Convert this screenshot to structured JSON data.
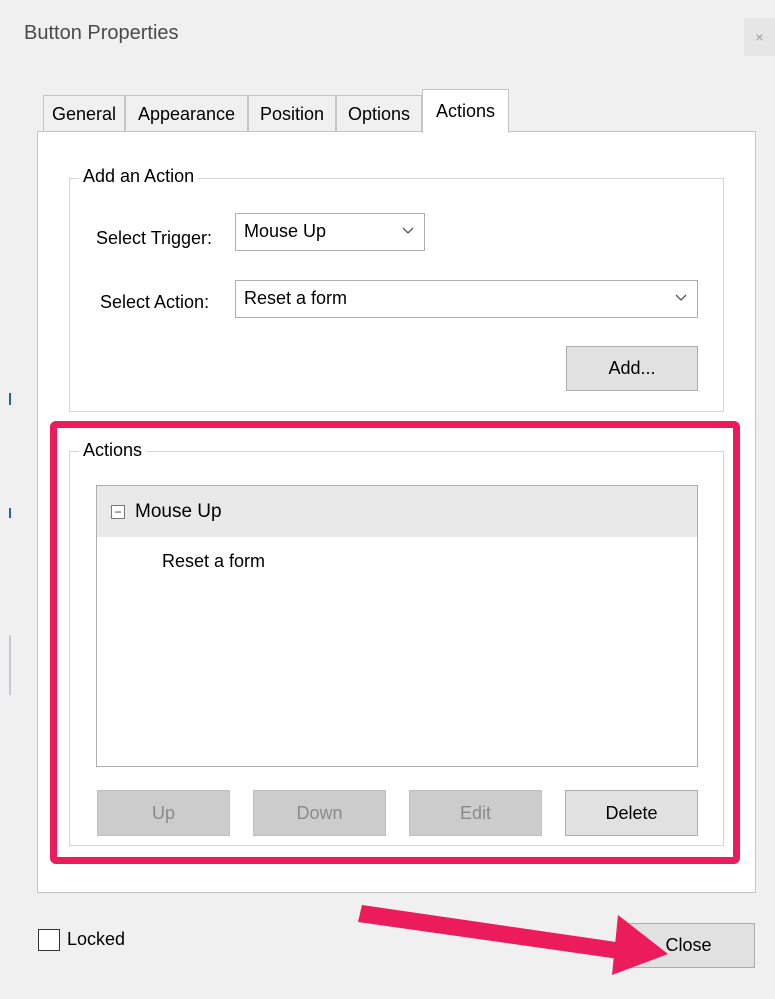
{
  "window": {
    "title": "Button Properties",
    "close_glyph": "×"
  },
  "tabs": [
    {
      "label": "General",
      "active": false
    },
    {
      "label": "Appearance",
      "active": false
    },
    {
      "label": "Position",
      "active": false
    },
    {
      "label": "Options",
      "active": false
    },
    {
      "label": "Actions",
      "active": true
    }
  ],
  "add_action": {
    "group_label": "Add an Action",
    "trigger_label": "Select Trigger:",
    "trigger_value": "Mouse Up",
    "action_label": "Select Action:",
    "action_value": "Reset a form",
    "add_button": "Add..."
  },
  "actions": {
    "group_label": "Actions",
    "tree": {
      "trigger": "Mouse Up",
      "expander": "−",
      "children": [
        "Reset a form"
      ]
    },
    "buttons": {
      "up": "Up",
      "down": "Down",
      "edit": "Edit",
      "delete": "Delete"
    }
  },
  "footer": {
    "locked_label": "Locked",
    "locked_checked": false,
    "close_button": "Close"
  },
  "annotation": {
    "highlight_color": "#ec1c5c",
    "arrow_color": "#ec1c5c"
  },
  "chevron": "⌵"
}
